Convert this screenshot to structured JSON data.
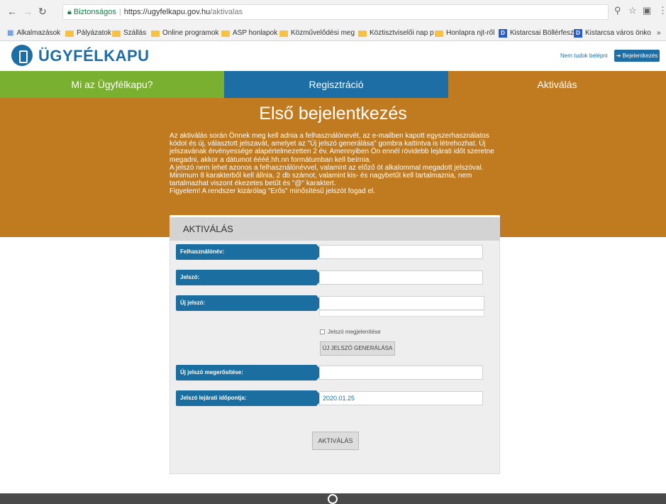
{
  "browser": {
    "secure_label": "Biztonságos",
    "url_host": "https://ugyfelkapu.gov.hu",
    "url_path": "/aktivalas"
  },
  "bookmarks": [
    "Alkalmazások",
    "Pályázatok",
    "Szállás",
    "Online programok",
    "ASP honlapok",
    "Közművelődési meg",
    "Köztisztviselői nap p",
    "Honlapra njt-ről",
    "Kistarcsai Böllérfeszti",
    "Kistarcsa város önko"
  ],
  "bookmarks_more": "»",
  "header": {
    "logo_text": "ÜGYFÉLKAPU",
    "forgot_link": "Nem tudok belépni",
    "login_button": "Bejelentkezés"
  },
  "tabs": [
    {
      "label": "Mi az Ügyfélkapu?",
      "color": "#7ab02f"
    },
    {
      "label": "Regisztráció",
      "color": "#1c6ea4"
    },
    {
      "label": "Aktiválás",
      "color": "#c07a1f"
    }
  ],
  "banner": {
    "title": "Első bejelentkezés",
    "paragraphs": [
      "Az aktiválás során Önnek meg kell adnia a felhasználónevét, az e-mailben kapott egyszerhasználatos kódot és új, választott jelszavát, amelyet az \"Új jelszó generálása\" gombra kattintva is létrehozhat. Új jelszavának érvényessége alapértelmezetten 2 év. Amennyiben Ön ennél rövidebb lejárati időt szeretne megadni, akkor a dátumot éééé.hh.nn formátumban kell beírnia.",
      "A jelszó nem lehet azonos a felhasználónévvel, valamint az előző öt alkalommal megadott jelszóval. Minimum 8 karakterből kell állnia, 2 db számot, valamint kis- és nagybetűt kell tartalmaznia, nem tartalmazhat viszont ékezetes betűt és \"@\" karaktert.",
      "Figyelem! A rendszer kizárólag \"Erős\" minősítésű jelszót fogad el."
    ]
  },
  "form": {
    "title": "AKTIVÁLÁS",
    "username_label": "Felhasználónév:",
    "password_label": "Jelszó:",
    "new_password_label": "Új jelszó:",
    "show_password_label": "Jelszó megjelenítése",
    "generate_button": "ÚJ JELSZÓ GENERÁLÁSA",
    "confirm_label": "Új jelszó megerősítése:",
    "expiry_label": "Jelszó lejárati időpontja:",
    "expiry_value": "2020.01.25",
    "submit_button": "AKTIVÁLÁS"
  }
}
